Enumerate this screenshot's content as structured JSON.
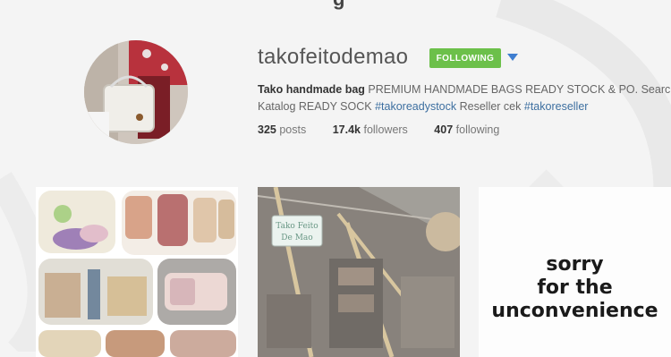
{
  "header": {
    "partial_text": "g"
  },
  "profile": {
    "username": "takofeitodemao",
    "follow_label": "FOLLOWING",
    "bio_name": "Tako handmade bag",
    "bio_line1": "PREMIUM HANDMADE BAGS READY STOCK & PO. Search",
    "bio_line2_prefix": "Katalog READY SOCK",
    "bio_tag1": "#takoreadystock",
    "bio_line2_mid": "Reseller cek",
    "bio_tag2": "#takoreseller",
    "posts_count": "325",
    "posts_label": "posts",
    "followers_count": "17.4k",
    "followers_label": "followers",
    "following_count": "407",
    "following_label": "following"
  },
  "overlay": {
    "line1": "sorry",
    "line2": "for the",
    "line3": "unconvenience"
  },
  "tiles": [
    {
      "kind": "bag-collage"
    },
    {
      "kind": "booth-photo",
      "sign_line1": "Tako Feito",
      "sign_line2": "De Mao"
    },
    {
      "kind": "blank"
    }
  ],
  "colors": {
    "follow_green": "#6cc04a",
    "link_blue": "#3d6fa0",
    "caret_blue": "#3f7ed0"
  }
}
